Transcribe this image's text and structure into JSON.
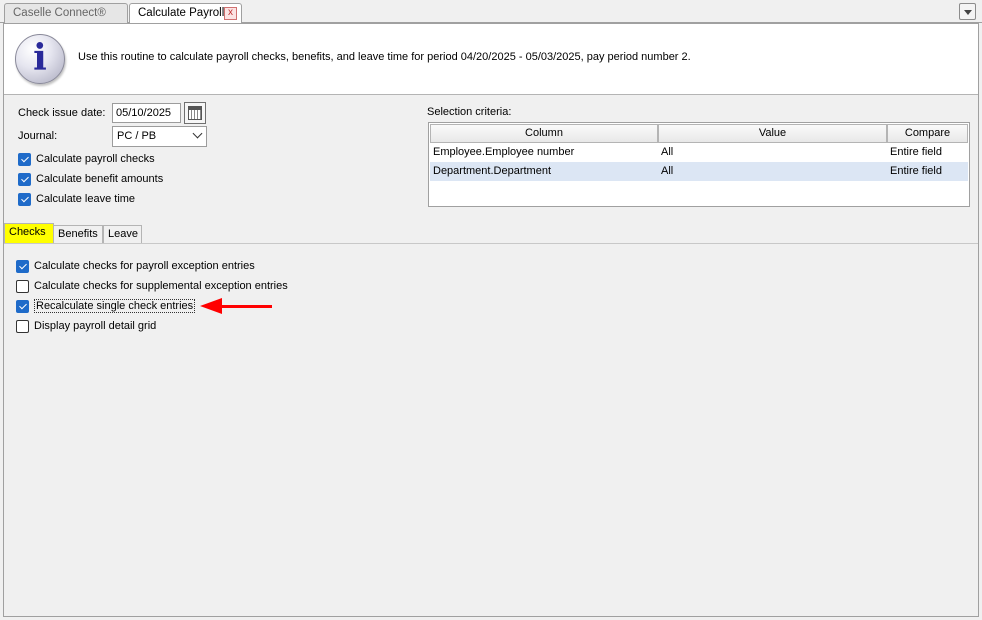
{
  "tabs": {
    "inactive_label": "Caselle Connect®",
    "active_label": "Calculate Payroll",
    "close_glyph": "x"
  },
  "info": {
    "icon_glyph": "i",
    "message": "Use this routine to calculate payroll checks, benefits, and leave time for period 04/20/2025 - 05/03/2025, pay period number 2."
  },
  "form": {
    "check_issue_date_label": "Check issue date:",
    "check_issue_date_value": "05/10/2025",
    "journal_label": "Journal:",
    "journal_value": "PC / PB",
    "calc_payroll_checks": "Calculate payroll checks",
    "calc_benefit_amounts": "Calculate benefit amounts",
    "calc_leave_time": "Calculate leave time"
  },
  "selection": {
    "label": "Selection criteria:",
    "columns": [
      "Column",
      "Value",
      "Compare"
    ],
    "rows": [
      [
        "Employee.Employee number",
        "All",
        "Entire field"
      ],
      [
        "Department.Department",
        "All",
        "Entire field"
      ]
    ]
  },
  "subtabs": [
    "Checks",
    "Benefits",
    "Leave"
  ],
  "checks_options": {
    "opt1": "Calculate checks for payroll exception entries",
    "opt2": "Calculate checks for supplemental exception entries",
    "opt3": "Recalculate single check entries",
    "opt4": "Display payroll detail grid"
  },
  "colors": {
    "highlight_tab": "#ffff00",
    "annotation_arrow": "#ff0000",
    "checkbox_checked": "#1f6bc9"
  }
}
